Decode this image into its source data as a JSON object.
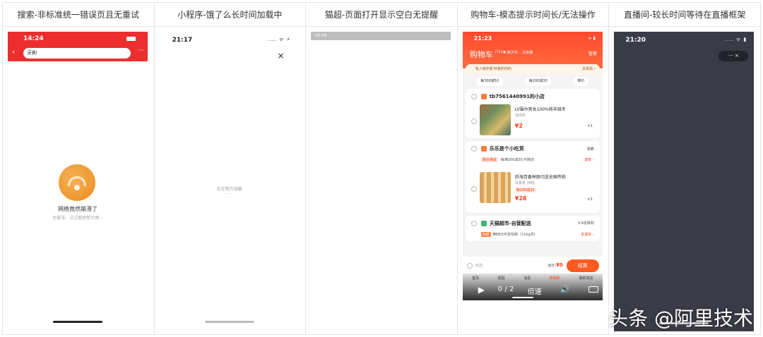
{
  "columns": [
    {
      "title": "搜索-非标准统一错误页且无重试"
    },
    {
      "title": "小程序-饿了么长时间加载中"
    },
    {
      "title": "猫超-页面打开显示空白无提醒"
    },
    {
      "title": "购物车-模态提示时间长/无法操作"
    },
    {
      "title": "直播间-较长时间等待在直播框架"
    }
  ],
  "search_page": {
    "time": "14:24",
    "back_icon": "back-arrow-icon",
    "query": "牙刷",
    "more": "···",
    "error_title": "网络竟然崩溃了",
    "error_sub": "别紧张，试试看刷新页面~"
  },
  "miniprogram_page": {
    "time": "21:17",
    "status": ".... ᯤ ⚡",
    "close": "×",
    "loading_text": "正在努力加载",
    "loading_dots": "···"
  },
  "maochao_page": {
    "statusbar_text": "16:06"
  },
  "cart_page": {
    "time": "21:23",
    "status": "ᯤ ▮",
    "title": "购物车",
    "count": "(71)",
    "location": "♥ 新沂市... 北京路",
    "manage": "管理",
    "note": "有人给你看TA我的你的",
    "note_more": "去看看 ›",
    "coupons": [
      "每300减50",
      "每200减30",
      "降价"
    ],
    "shop1": {
      "name": "tb7561440991的小店",
      "product": "LV围巾男女100%纯羊绒冬",
      "spec": "浅绿色",
      "price": "¥2",
      "qty": "×1"
    },
    "shop2": {
      "name": "乐乐是个小吃货",
      "coupon_btn": "领券",
      "promo_tag": "跨店满减",
      "promo_text": "每满200减30,可跨店",
      "promo_link": "凑单 ›",
      "product": "后海百香林原闪送全国传统",
      "spec": "百香卷 (6根)",
      "tag": "每200减30",
      "price": "¥28",
      "qty": "×1"
    },
    "shop3": {
      "name": "天猫超市-自营配送",
      "right": "9.9去换购",
      "tag": "包邮",
      "text": "满88元可享包邮（21kg内）",
      "link": "去凑单 ›"
    },
    "footer": {
      "select_all": "全选",
      "total_label": "合计:",
      "total_value": "¥0",
      "checkout": "结算"
    },
    "video_bar": {
      "tabs": [
        "首页",
        "逛逛",
        "消息",
        "购物车",
        "我的淘宝"
      ],
      "time": "0 / 2",
      "speed": "倍速"
    }
  },
  "live_page": {
    "time": "21:20",
    "status": ".... ᯤ ▮",
    "capsule": "··· ×"
  },
  "watermark": "头条 @阿里技术"
}
